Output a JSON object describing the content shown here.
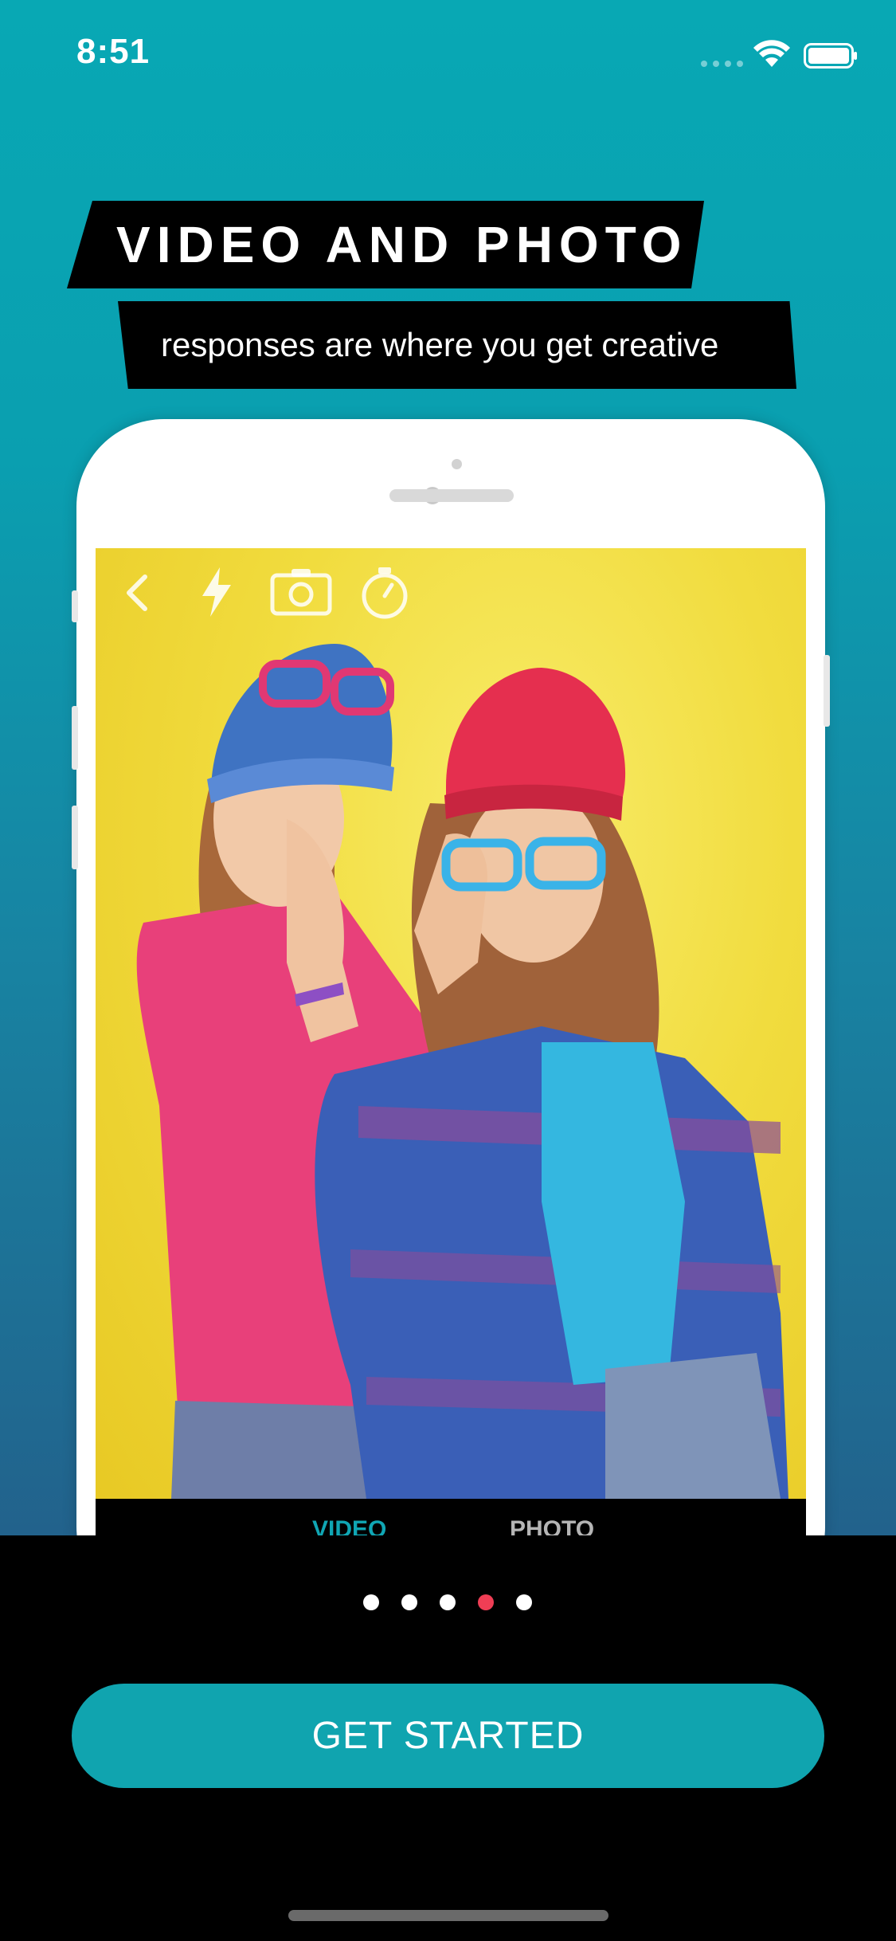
{
  "status_bar": {
    "time": "8:51",
    "wifi_icon": "wifi-icon",
    "battery_icon": "battery-icon"
  },
  "headline": {
    "title": "VIDEO AND PHOTO",
    "subtitle": "responses are where you get creative"
  },
  "phone_mockup": {
    "camera_controls": [
      "back-icon",
      "flash-icon",
      "switch-camera-icon",
      "timer-icon"
    ],
    "modes": {
      "video": "VIDEO",
      "photo": "PHOTO"
    },
    "photo_description_icon": "photo-two-girls-illustration"
  },
  "pager": {
    "count": 5,
    "active_index": 3,
    "active_color": "#ef3e55",
    "inactive_color": "#ffffff"
  },
  "cta": {
    "label": "GET STARTED",
    "color": "#10a4af"
  },
  "colors": {
    "brand_teal": "#0aa6b2",
    "background": "#000000"
  }
}
